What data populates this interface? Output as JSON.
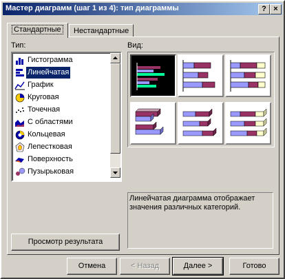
{
  "window": {
    "title": "Мастер диаграмм (шаг 1 из 4): тип диаграммы",
    "help_label": "?",
    "close_label": "×"
  },
  "tabs": [
    {
      "label": "Стандартные"
    },
    {
      "label": "Нестандартные"
    }
  ],
  "type_label": "Тип:",
  "view_label": "Вид:",
  "chart_types": [
    {
      "label": "Гистограмма",
      "icon": "column-chart-icon"
    },
    {
      "label": "Линейчатая",
      "icon": "bar-chart-icon"
    },
    {
      "label": "График",
      "icon": "line-chart-icon"
    },
    {
      "label": "Круговая",
      "icon": "pie-chart-icon"
    },
    {
      "label": "Точечная",
      "icon": "scatter-chart-icon"
    },
    {
      "label": "С областями",
      "icon": "area-chart-icon"
    },
    {
      "label": "Кольцевая",
      "icon": "doughnut-chart-icon"
    },
    {
      "label": "Лепестковая",
      "icon": "radar-chart-icon"
    },
    {
      "label": "Поверхность",
      "icon": "surface-chart-icon"
    },
    {
      "label": "Пузырьковая",
      "icon": "bubble-chart-icon"
    }
  ],
  "selected_type": "Линейчатая",
  "subtypes": [
    {
      "name": "clustered-bar"
    },
    {
      "name": "stacked-bar"
    },
    {
      "name": "100-stacked-bar"
    },
    {
      "name": "3d-clustered-bar"
    },
    {
      "name": "3d-stacked-bar"
    },
    {
      "name": "3d-100-stacked-bar"
    }
  ],
  "description": "Линейчатая диаграмма отображает значения различных категорий.",
  "preview_button": "Просмотр результата",
  "buttons": {
    "cancel": "Отмена",
    "back": "< Назад",
    "next": "Далее >",
    "finish": "Готово"
  },
  "colors": {
    "titlebar_start": "#0a246a",
    "titlebar_end": "#a6caf0",
    "dialog_bg": "#d4d0c8",
    "selection": "#0a246a",
    "series1": "#993366",
    "series2": "#9999ff",
    "series3": "#ffffcc",
    "selected_series": "#00ff99"
  }
}
